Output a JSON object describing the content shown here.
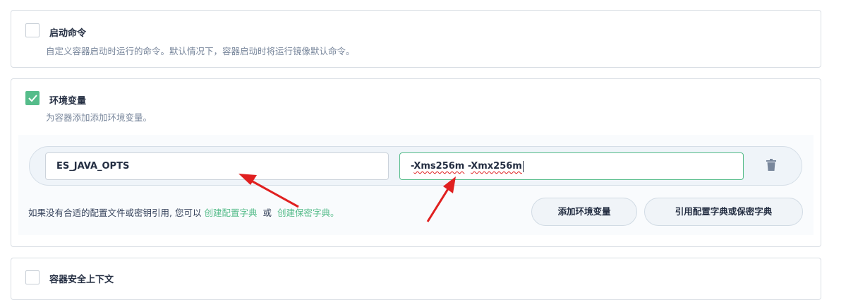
{
  "startup_command": {
    "title": "启动命令",
    "description": "自定义容器启动时运行的命令。默认情况下，容器启动时将运行镜像默认命令。",
    "checked": false
  },
  "env_vars": {
    "title": "环境变量",
    "description": "为容器添加添加环境变量。",
    "checked": true,
    "rows": [
      {
        "key": "ES_JAVA_OPTS",
        "value_part1": "-",
        "value_part2": "Xms256m",
        "value_part3": " -",
        "value_part4": "Xmx256m"
      }
    ],
    "hint_prefix": "如果没有合适的配置文件或密钥引用, 您可以",
    "hint_link1": "创建配置字典",
    "hint_mid": "或",
    "hint_link2": "创建保密字典。",
    "add_button": "添加环境变量",
    "ref_button": "引用配置字典或保密字典"
  },
  "security_context": {
    "title": "容器安全上下文",
    "checked": false
  },
  "colors": {
    "accent": "#55bc8a",
    "annotation_arrow": "#e02020"
  },
  "icons": {
    "delete": "trash-icon",
    "check": "check-icon"
  }
}
